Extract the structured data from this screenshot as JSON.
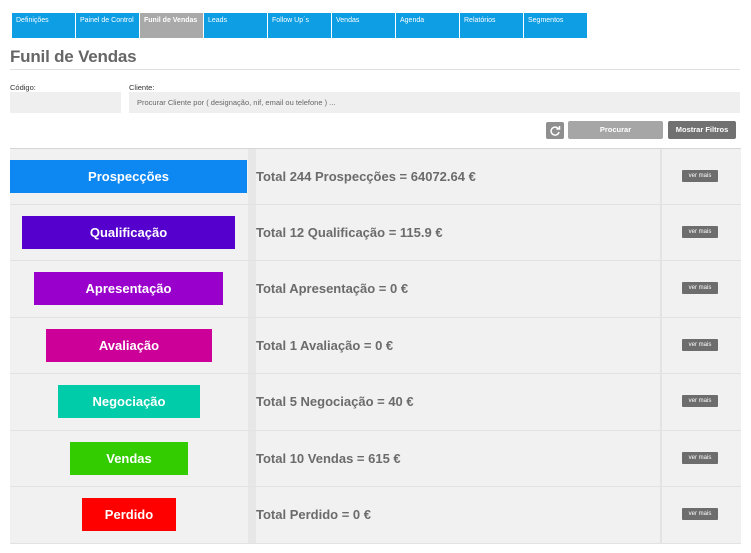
{
  "nav": {
    "tabs": [
      "Definições",
      "Painel de Control",
      "Funil de Vendas",
      "Leads",
      "Follow Up´s",
      "Vendas",
      "Agenda",
      "Relatórios",
      "Segmentos"
    ],
    "active": "Funil de Vendas"
  },
  "page": {
    "title": "Funil de Vendas"
  },
  "filters": {
    "codigo_label": "Código:",
    "codigo_value": "",
    "cliente_label": "Cliente:",
    "cliente_placeholder": "Procurar Cliente por ( designação, nif, email ou telefone ) ...",
    "refresh_icon": "refresh-icon",
    "search_label": "Procurar",
    "toggle_filters_label": "Mostrar Filtros"
  },
  "funnel": {
    "more_label": "ver mais",
    "stages": [
      {
        "name": "Prospecções",
        "total": "Total 244 Prospecções = 64072.64 €",
        "color": "#0d87f2"
      },
      {
        "name": "Qualificação",
        "total": "Total 12 Qualificação = 115.9 €",
        "color": "#5500cc"
      },
      {
        "name": "Apresentação",
        "total": "Total Apresentação = 0 €",
        "color": "#9900cc"
      },
      {
        "name": "Avaliação",
        "total": "Total 1 Avaliação = 0 €",
        "color": "#cc0099"
      },
      {
        "name": "Negociação",
        "total": "Total 5 Negociação = 40 €",
        "color": "#00ccaa"
      },
      {
        "name": "Vendas",
        "total": "Total 10 Vendas = 615 €",
        "color": "#33cc00"
      },
      {
        "name": "Perdido",
        "total": "Total Perdido = 0 €",
        "color": "#ff0000"
      }
    ]
  }
}
